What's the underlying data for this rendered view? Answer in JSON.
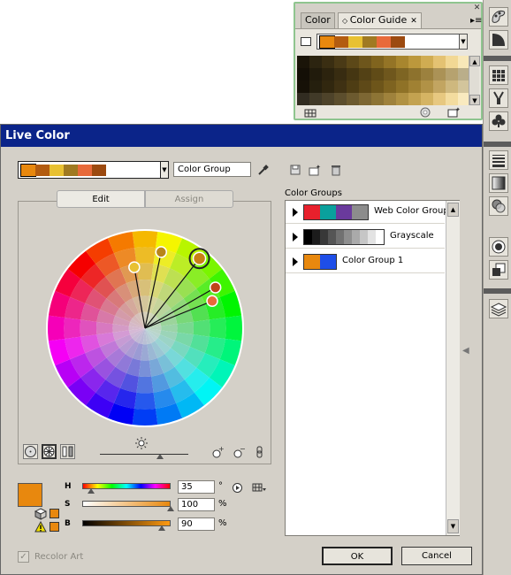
{
  "colors": {
    "title_bar": "#0b2489",
    "dialog_bg": "#d4d0c8",
    "panel_border": "#8fc58f",
    "base_color": "#e8880e"
  },
  "color_guide_panel": {
    "tabs": [
      {
        "label": "Color",
        "active": false
      },
      {
        "label": "Color Guide",
        "active": true,
        "icon": "double-arrow-icon"
      }
    ],
    "menu_icon": "panel-menu-icon",
    "close_icon": "close-icon",
    "harmony_swatches": [
      "#e8880e",
      "#b35c10",
      "#e8c132",
      "#a07a22",
      "#e86a3a",
      "#9c4a10"
    ],
    "variation_grid_columns": [
      "#1a1408",
      "#2c2410",
      "#3a2e12",
      "#4a3a16",
      "#5c4818",
      "#6e561c",
      "#80641e",
      "#947426",
      "#a8862e",
      "#bc983c",
      "#d0ac52",
      "#e4c272",
      "#f2d894",
      "#f8e8b8"
    ],
    "footer_icons": [
      "limit-swatches-icon",
      "edit-colors-icon",
      "save-group-icon"
    ]
  },
  "toolbar_icons": [
    "color-icon",
    "gradient-icon",
    "swatches-icon",
    "brushes-icon",
    "symbols-icon",
    "stroke-icon",
    "gradient-panel-icon",
    "transparency-icon",
    "appearance-icon",
    "graphic-styles-icon",
    "layers-icon"
  ],
  "dialog": {
    "title": "Live Color",
    "current_group": {
      "swatches": [
        "#e8880e",
        "#b35c10",
        "#e8c132",
        "#a07a22",
        "#e86a3a",
        "#9c4a10"
      ],
      "name": "Color Group"
    },
    "icons": [
      "eyedropper-icon",
      "save-icon",
      "new-group-icon",
      "delete-icon"
    ],
    "tabs": {
      "edit": "Edit",
      "assign": "Assign"
    },
    "hsb": {
      "h": {
        "label": "H",
        "value": "35",
        "unit": "°",
        "level": 0.1
      },
      "s": {
        "label": "S",
        "value": "100",
        "unit": "%",
        "level": 1.0
      },
      "b": {
        "label": "B",
        "value": "90",
        "unit": "%",
        "level": 0.9
      }
    },
    "recolor_art": {
      "label": "Recolor Art",
      "checked": true,
      "disabled": true
    },
    "color_groups_label": "Color Groups",
    "color_groups": [
      {
        "name": "Web Color Group",
        "swatches": [
          "#e8202c",
          "#0aa09c",
          "#6a3a9c",
          "#8c8c8c"
        ]
      },
      {
        "name": "Grayscale",
        "swatches": [
          "#000000",
          "#1c1c1c",
          "#383838",
          "#555555",
          "#717171",
          "#8e8e8e",
          "#aaaaaa",
          "#c6c6c6",
          "#e3e3e3",
          "#ffffff"
        ]
      },
      {
        "name": "Color Group 1",
        "swatches": [
          "#e8880e",
          "#1e4ee8"
        ]
      }
    ],
    "buttons": {
      "ok": "OK",
      "cancel": "Cancel"
    }
  }
}
